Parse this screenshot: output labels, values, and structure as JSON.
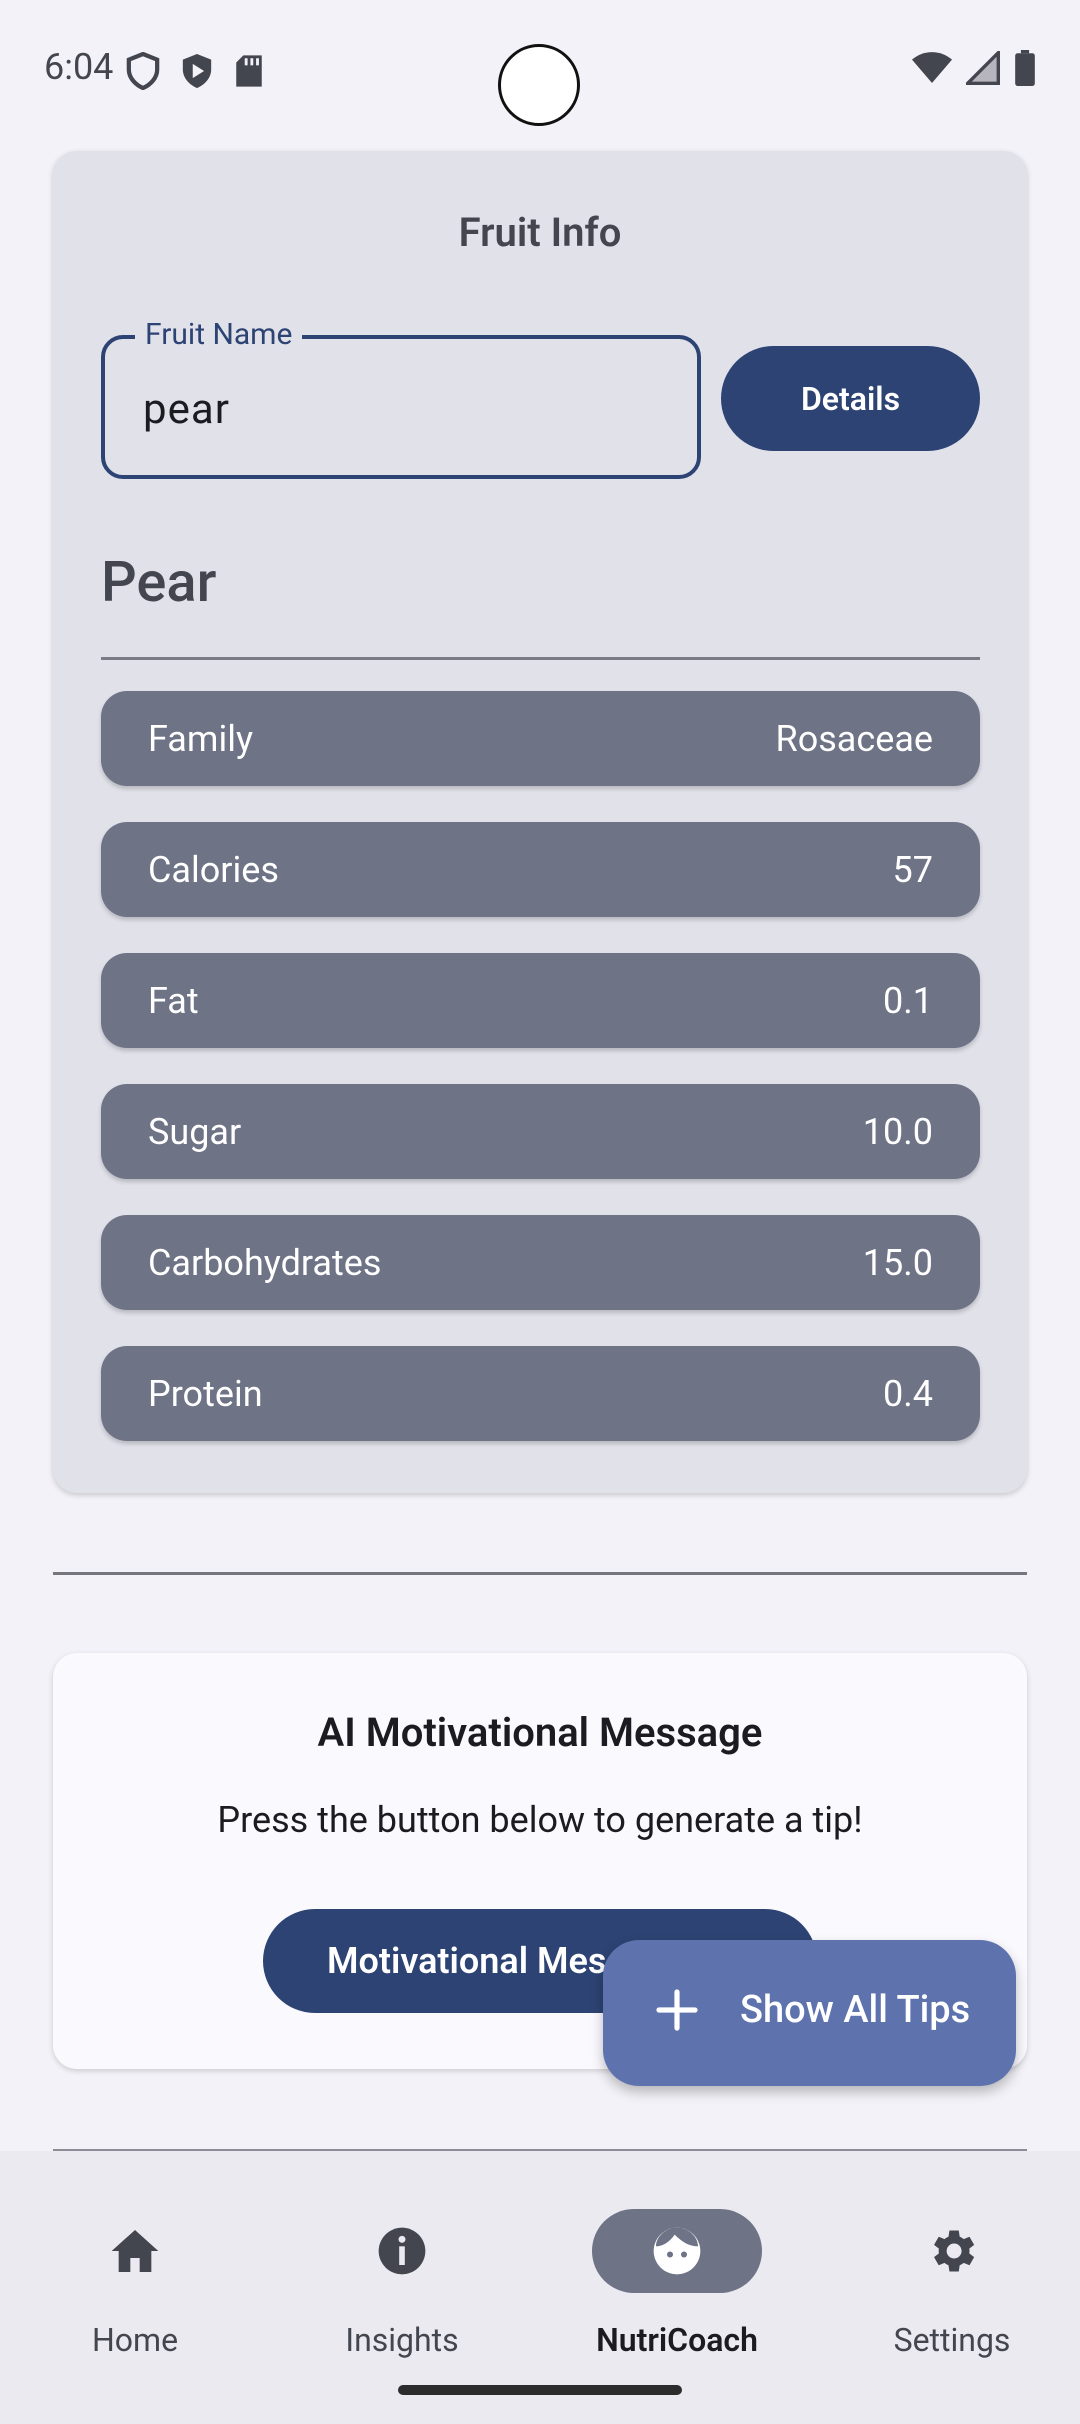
{
  "status_bar": {
    "time": "6:04",
    "icons_left": [
      "shield-icon",
      "play-shield-icon",
      "sd-card-icon"
    ],
    "icons_right": [
      "wifi-icon",
      "signal-icon",
      "battery-icon"
    ]
  },
  "fruit_card": {
    "title": "Fruit Info",
    "field_label": "Fruit Name",
    "field_value": "pear",
    "details_button": "Details",
    "fruit_name": "Pear",
    "rows": [
      {
        "label": "Family",
        "value": "Rosaceae"
      },
      {
        "label": "Calories",
        "value": "57"
      },
      {
        "label": "Fat",
        "value": "0.1"
      },
      {
        "label": "Sugar",
        "value": "10.0"
      },
      {
        "label": "Carbohydrates",
        "value": "15.0"
      },
      {
        "label": "Protein",
        "value": "0.4"
      }
    ]
  },
  "message_card": {
    "title": "AI Motivational Message",
    "text": "Press the button below to generate a tip!",
    "button": "Motivational Message"
  },
  "fab": {
    "label": "Show All Tips",
    "icon": "plus-icon"
  },
  "bottom_nav": {
    "items": [
      {
        "label": "Home",
        "icon": "home-icon",
        "active": false
      },
      {
        "label": "Insights",
        "icon": "info-icon",
        "active": false
      },
      {
        "label": "NutriCoach",
        "icon": "face-icon",
        "active": true
      },
      {
        "label": "Settings",
        "icon": "gear-icon",
        "active": false
      }
    ]
  },
  "colors": {
    "primary": "#2d4373",
    "row_bg": "#6e7386",
    "card_bg": "#e1e1ea",
    "fab_bg": "#5e72ad"
  }
}
